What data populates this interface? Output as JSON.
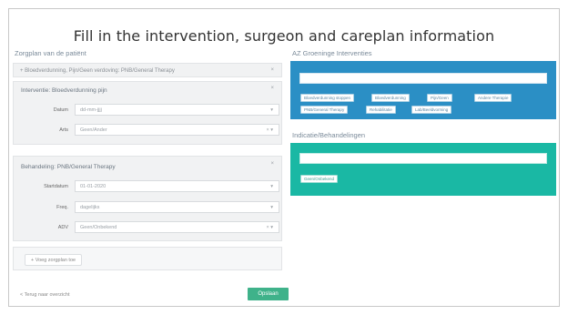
{
  "title": "Fill in the intervention, surgeon and careplan information",
  "left": {
    "heading": "Zorgplan van de patiënt",
    "summary_line": "+ Bloedverdunning, Pijn/Geen verdoving: PNB/General Therapy",
    "intervention": {
      "title": "Interventie: Bloedverdunning pijn",
      "fields": [
        {
          "label": "Datum",
          "value": "dd-mm-jjjj"
        },
        {
          "label": "Arts",
          "value": "Geen/Ander"
        }
      ]
    },
    "treatment": {
      "title": "Behandeling: PNB/General Therapy",
      "fields": [
        {
          "label": "Startdatum",
          "value": "01-01-2020"
        },
        {
          "label": "Freq.",
          "value": "dagelijks"
        },
        {
          "label": "ADV",
          "value": "Geen/Onbekend"
        }
      ]
    },
    "add_button": "+ Voeg zorgplan toe",
    "footer_link": "< Terug naar overzicht",
    "save_button": "Opslaan"
  },
  "right": {
    "blue_heading": "AZ Groeninge Interventies",
    "blue_tags": [
      "Bloedverdunning stoppen",
      "Bloedverdunning",
      "Pijn/Geen",
      "Andere Therapie",
      "PNB/General Therapy",
      "Rehabilitatie",
      "Lab/Beeldvorming"
    ],
    "teal_heading": "Indicatie/Behandelingen",
    "teal_tags": [
      "Geen/Onbekend"
    ]
  },
  "colors": {
    "blue_panel": "#2b8fc5",
    "teal_panel": "#1ab8a4",
    "save_button": "#3fb28a"
  }
}
